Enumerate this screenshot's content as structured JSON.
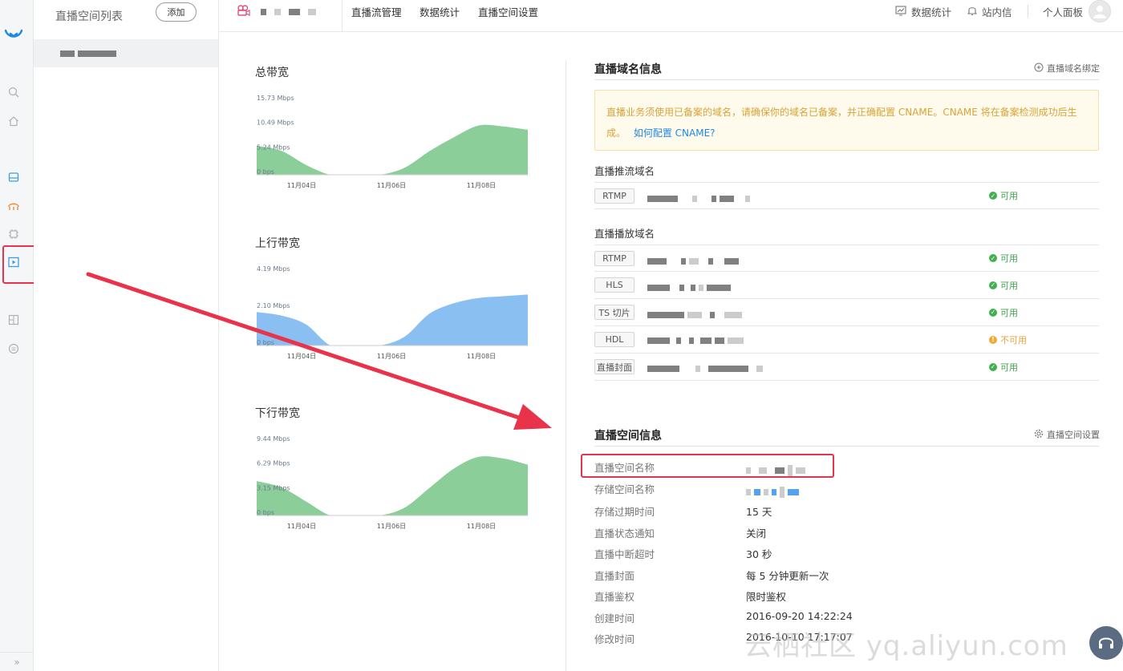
{
  "colors": {
    "accent": "#1e88e5",
    "ok": "#41b04e",
    "warn": "#f0a932",
    "green_area": "#7ec98f",
    "blue_area": "#7db8ef",
    "highlight": "#e8334a"
  },
  "rail": {
    "icons": [
      "logo-icon",
      "search-icon",
      "home-icon",
      "storage-icon",
      "cdn-icon",
      "chip-icon",
      "live-icon",
      "image-icon",
      "list-icon"
    ],
    "expand": "»"
  },
  "space_panel": {
    "title": "直播空间列表",
    "add_label": "添加"
  },
  "topnav": {
    "links": [
      "直播流管理",
      "数据统计",
      "直播空间设置"
    ],
    "stats": "数据统计",
    "messages": "站内信",
    "panel": "个人面板"
  },
  "chart_data": [
    {
      "type": "area",
      "title": "总带宽",
      "yticks": [
        "15.73 Mbps",
        "10.49 Mbps",
        "5.24 Mbps",
        "0 bps"
      ],
      "ylim": [
        0,
        15.73
      ],
      "x": [
        "11月04日",
        "11月06日",
        "11月08日"
      ],
      "values": [
        6.2,
        5.1,
        2.1,
        0,
        0,
        0,
        1.5,
        5.0,
        8.0,
        10.5,
        10.3,
        9.6
      ],
      "color": "#7ec98f"
    },
    {
      "type": "area",
      "title": "上行带宽",
      "yticks": [
        "4.19 Mbps",
        "2.10 Mbps",
        "0 bps"
      ],
      "ylim": [
        0,
        4.19
      ],
      "x": [
        "11月04日",
        "11月06日",
        "11月08日"
      ],
      "values": [
        1.9,
        1.7,
        1.2,
        0,
        0,
        0,
        0.5,
        1.8,
        2.4,
        2.7,
        2.8,
        2.9
      ],
      "color": "#7db8ef"
    },
    {
      "type": "area",
      "title": "下行带宽",
      "yticks": [
        "9.44 Mbps",
        "6.29 Mbps",
        "3.15 Mbps",
        "0 bps"
      ],
      "ylim": [
        0,
        9.44
      ],
      "x": [
        "11月04日",
        "11月06日",
        "11月08日"
      ],
      "values": [
        4.4,
        3.6,
        1.8,
        0,
        0,
        0,
        1.0,
        3.5,
        6.0,
        7.5,
        7.3,
        6.5
      ],
      "color": "#7ec98f"
    }
  ],
  "domain_info": {
    "title": "直播域名信息",
    "bind_action": "直播域名绑定",
    "notice_text": "直播业务须使用已备案的域名，请确保你的域名已备案，并正确配置 CNAME。CNAME 将在备案检测成功后生成。",
    "notice_link": "如何配置 CNAME?",
    "push_title": "直播推流域名",
    "push": [
      {
        "tag": "RTMP",
        "status": "可用",
        "ok": true
      }
    ],
    "play_title": "直播播放域名",
    "play": [
      {
        "tag": "RTMP",
        "status": "可用",
        "ok": true
      },
      {
        "tag": "HLS",
        "status": "可用",
        "ok": true
      },
      {
        "tag": "TS 切片",
        "status": "可用",
        "ok": true
      },
      {
        "tag": "HDL",
        "status": "不可用",
        "ok": false
      },
      {
        "tag": "直播封面",
        "status": "可用",
        "ok": true
      }
    ]
  },
  "space_info": {
    "title": "直播空间信息",
    "settings_action": "直播空间设置",
    "rows": [
      {
        "k": "直播空间名称",
        "v": ""
      },
      {
        "k": "存储空间名称",
        "v": ""
      },
      {
        "k": "存储过期时间",
        "v": "15 天"
      },
      {
        "k": "直播状态通知",
        "v": "关闭"
      },
      {
        "k": "直播中断超时",
        "v": "30 秒"
      },
      {
        "k": "直播封面",
        "v": "每 5 分钟更新一次"
      },
      {
        "k": "直播鉴权",
        "v": "限时鉴权"
      },
      {
        "k": "创建时间",
        "v": "2016-09-20 14:22:24"
      },
      {
        "k": "修改时间",
        "v": "2016-10-10 17:17:07"
      }
    ]
  },
  "watermark": "云栖社区 yq.aliyun.com"
}
